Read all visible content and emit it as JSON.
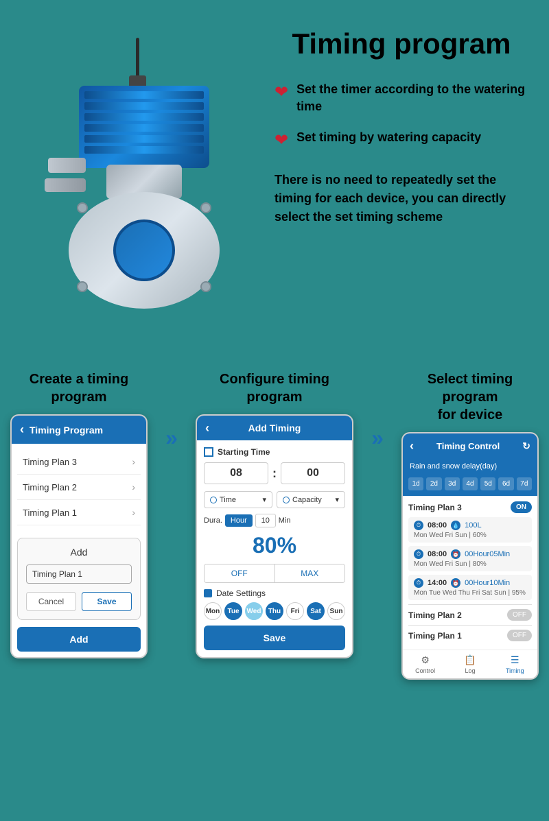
{
  "page": {
    "title": "Timing program",
    "background_color": "#2a8a8a"
  },
  "top_section": {
    "bullet1": {
      "icon": "❤",
      "text": "Set the timer according to the watering time"
    },
    "bullet2": {
      "icon": "❤",
      "text": "Set timing by watering capacity"
    },
    "description": "There is no need to repeatedly set the timing for each device, you can directly select the set timing scheme"
  },
  "steps": [
    {
      "title": "Create a timing program",
      "phone": {
        "header": "Timing Program",
        "items": [
          "Timing Plan 3",
          "Timing Plan 2",
          "Timing Plan 1"
        ],
        "dialog_add_label": "Add",
        "dialog_input_value": "Timing Plan 1",
        "btn_cancel": "Cancel",
        "btn_save": "Save",
        "footer_btn": "Add"
      }
    },
    {
      "title": "Configure timing program",
      "phone": {
        "header": "Add Timing",
        "starting_time_label": "Starting Time",
        "hour": "08",
        "minute": "00",
        "dropdown1": "Time",
        "dropdown2": "Capacity",
        "dura_label": "Dura.",
        "dura_unit_hour": "Hour",
        "dura_value": "10",
        "dura_unit_min": "Min",
        "percent": "80%",
        "toggle_off": "OFF",
        "toggle_max": "MAX",
        "date_label": "Date Settings",
        "days": [
          {
            "label": "Mon",
            "active": false
          },
          {
            "label": "Tue",
            "active": true
          },
          {
            "label": "Wed",
            "active": false
          },
          {
            "label": "Thu",
            "active": true
          },
          {
            "label": "Fri",
            "active": false
          },
          {
            "label": "Sat",
            "active": true
          },
          {
            "label": "Sun",
            "active": false
          }
        ],
        "save_btn": "Save"
      }
    },
    {
      "title": "Select timing program for device",
      "phone": {
        "header": "Timing Control",
        "delay_label": "Rain and snow delay(day)",
        "day_tabs": [
          "1d",
          "2d",
          "3d",
          "4d",
          "5d",
          "6d",
          "7d"
        ],
        "plan3_name": "Timing Plan 3",
        "plan3_toggle": "ON",
        "timing_items": [
          {
            "time": "08:00",
            "value": "100L",
            "sub": "Mon Wed Fri Sun | 60%"
          },
          {
            "time": "08:00",
            "value": "00Hour05Min",
            "sub": "Mon Wed Fri Sun | 80%"
          },
          {
            "time": "14:00",
            "value": "00Hour10Min",
            "sub": "Mon Tue Wed Thu Fri Sat Sun | 95%"
          }
        ],
        "plan2_name": "Timing Plan 2",
        "plan2_toggle": "OFF",
        "plan1_name": "Timing Plan 1",
        "plan1_toggle": "OFF",
        "footer_items": [
          "Control",
          "Log",
          "Timing"
        ]
      }
    }
  ],
  "arrows": [
    "»",
    "»"
  ]
}
